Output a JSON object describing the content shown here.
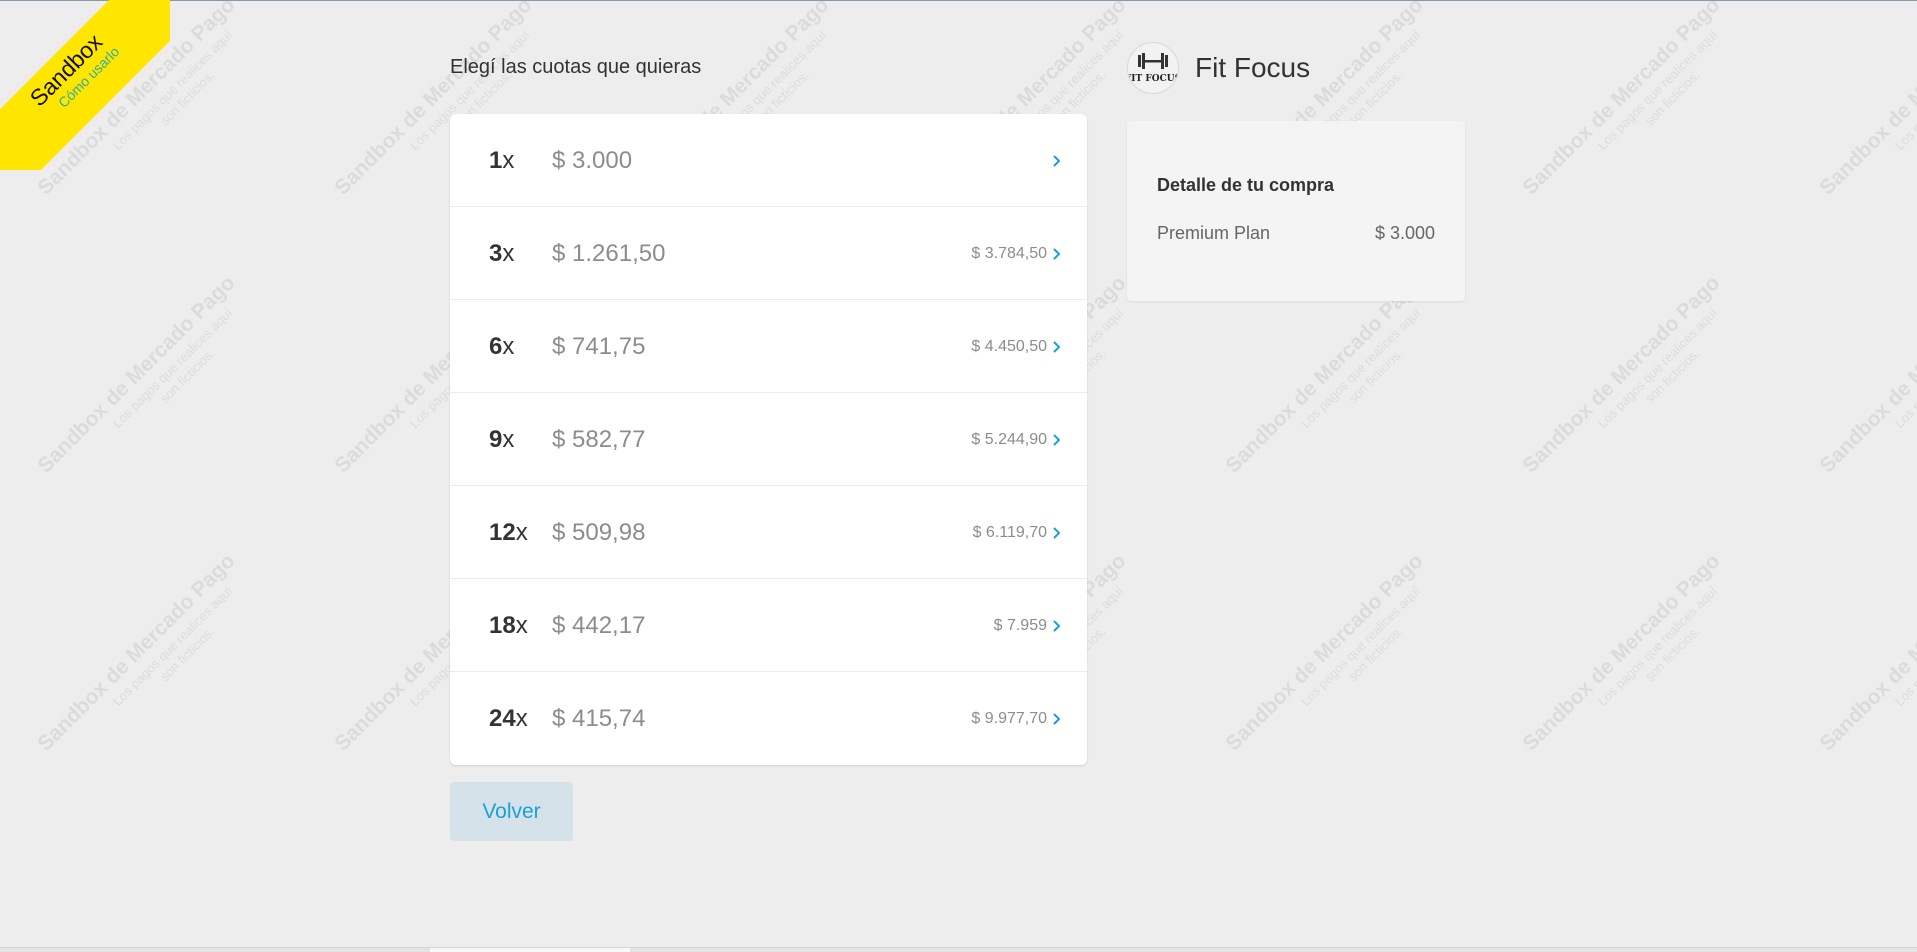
{
  "sandbox": {
    "title": "Sandbox",
    "link": "Cómo usarlo"
  },
  "watermark": {
    "line1": "Sandbox de Mercado Pago",
    "line2": "Los pagos que realices aquí",
    "line3": "son ficticios."
  },
  "installments": {
    "title": "Elegí las cuotas que quieras",
    "options": [
      {
        "count": "1",
        "suffix": "x",
        "amount": "$ 3.000",
        "total": ""
      },
      {
        "count": "3",
        "suffix": "x",
        "amount": "$ 1.261,50",
        "total": "$ 3.784,50"
      },
      {
        "count": "6",
        "suffix": "x",
        "amount": "$ 741,75",
        "total": "$ 4.450,50"
      },
      {
        "count": "9",
        "suffix": "x",
        "amount": "$ 582,77",
        "total": "$ 5.244,90"
      },
      {
        "count": "12",
        "suffix": "x",
        "amount": "$ 509,98",
        "total": "$ 6.119,70"
      },
      {
        "count": "18",
        "suffix": "x",
        "amount": "$ 442,17",
        "total": "$ 7.959"
      },
      {
        "count": "24",
        "suffix": "x",
        "amount": "$ 415,74",
        "total": "$ 9.977,70"
      }
    ]
  },
  "back_button": {
    "label": "Volver"
  },
  "merchant": {
    "name": "Fit Focus",
    "logo_text": "FIT FOCUS"
  },
  "summary": {
    "title": "Detalle de tu compra",
    "item_name": "Premium Plan",
    "item_price": "$ 3.000"
  },
  "colors": {
    "accent": "#1ca0dc",
    "background": "#ededed",
    "ribbon": "#ffe600",
    "ribbon_link": "#2eaea2",
    "button_bg": "#d5e2ea"
  }
}
